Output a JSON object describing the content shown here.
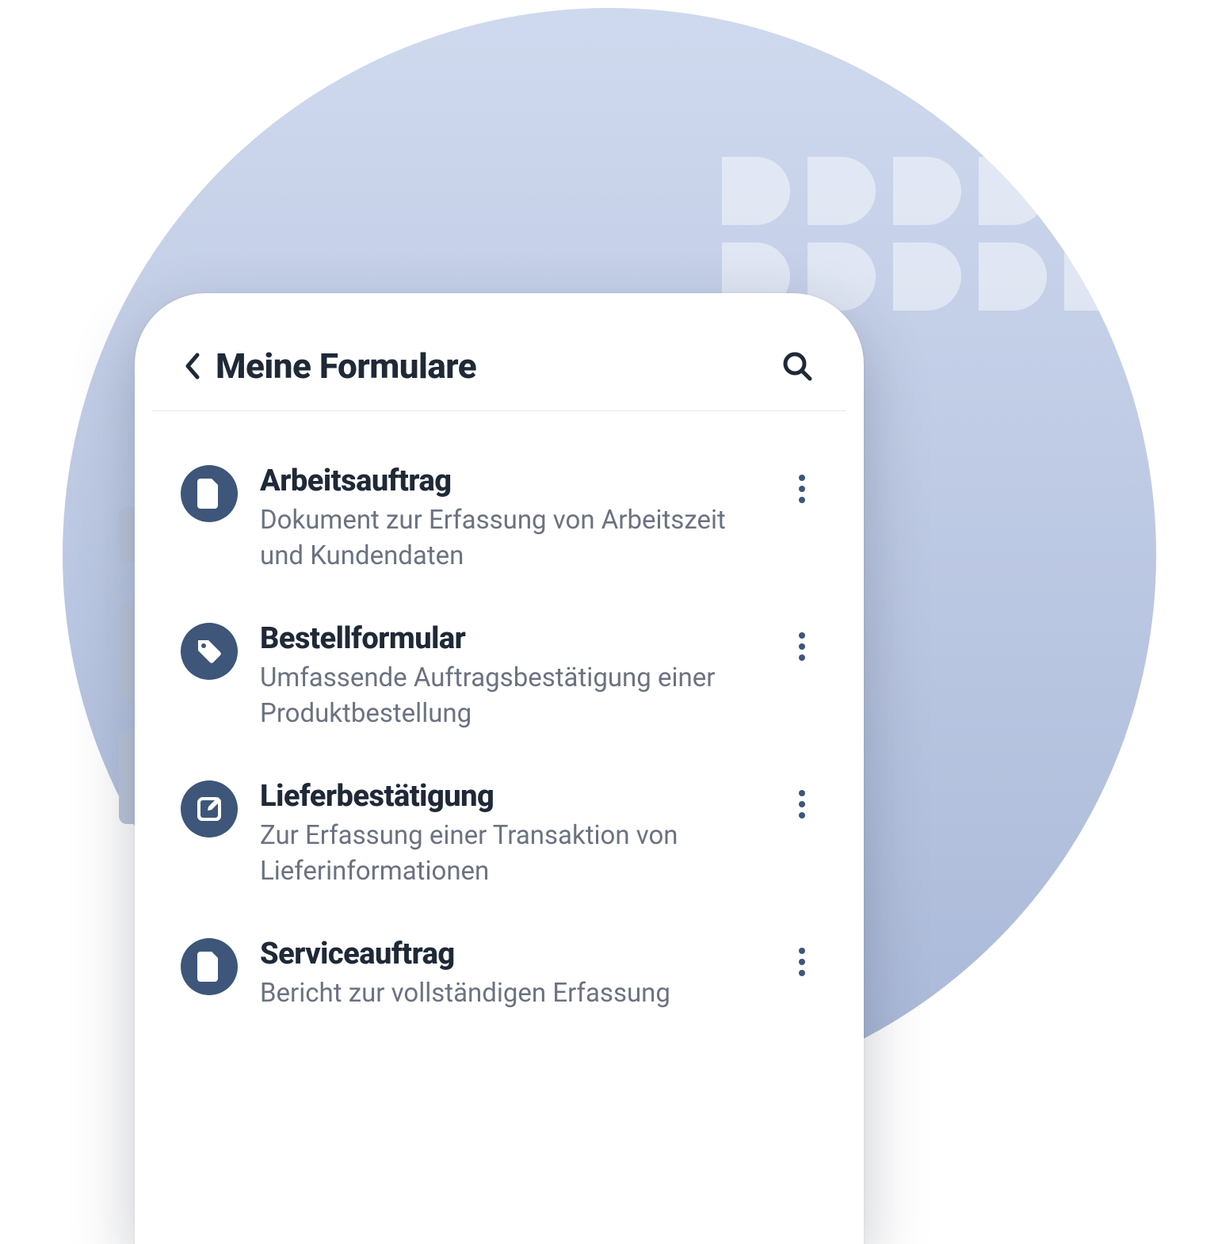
{
  "header": {
    "title": "Meine Formulare"
  },
  "forms": [
    {
      "icon": "document-icon",
      "title": "Arbeitsauftrag",
      "description": "Dokument zur Erfassung von Arbeitszeit und Kundendaten"
    },
    {
      "icon": "tag-icon",
      "title": "Bestellformular",
      "description": "Umfassende Auftragsbestätigung einer Produktbestellung"
    },
    {
      "icon": "edit-icon",
      "title": "Lieferbestätigung",
      "description": "Zur Erfassung einer Transaktion von Lieferinformationen"
    },
    {
      "icon": "document-icon",
      "title": "Serviceauftrag",
      "description": "Bericht zur vollständigen Erfassung"
    }
  ],
  "colors": {
    "accent": "#3d5679",
    "textDark": "#1f2937",
    "textMuted": "#6b7280"
  }
}
